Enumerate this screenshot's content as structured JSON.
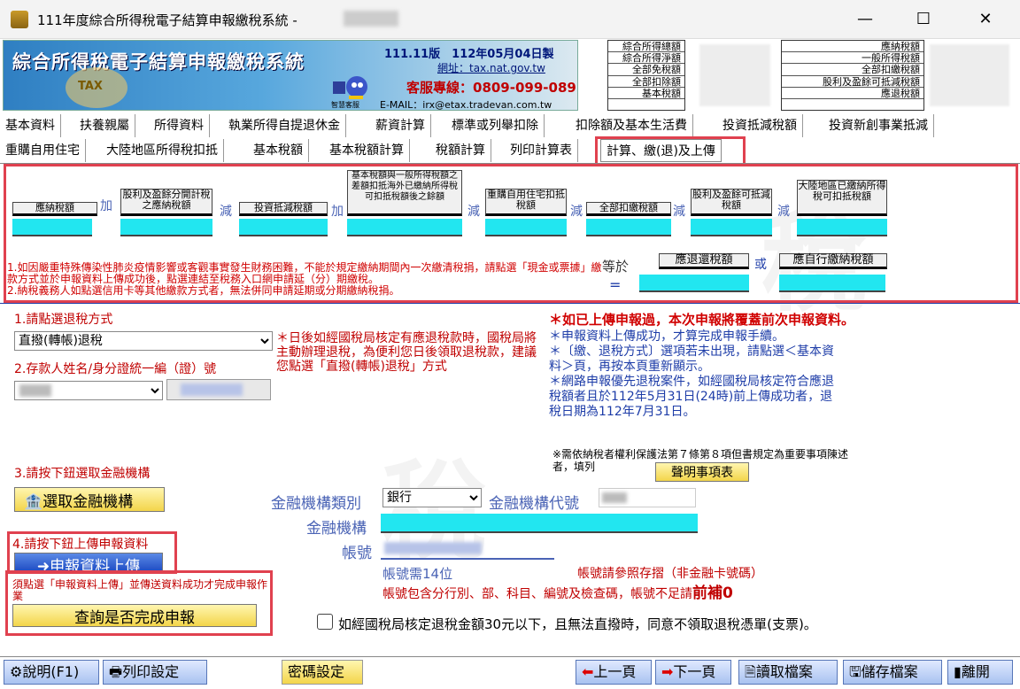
{
  "window": {
    "title": "111年度綜合所得稅電子結算申報繳稅系統 -",
    "minimize": "—",
    "maximize": "☐",
    "close": "✕"
  },
  "banner": {
    "title": "綜合所得稅電子結算申報繳稅系統",
    "version": "111.11版　112年05月04日製",
    "url": "網址：tax.nat.gov.tw",
    "phone": "客服專線：0809-099-089",
    "email": "E-MAIL：irx@etax.tradevan.com.tw",
    "robot_label": "智慧客服",
    "tax_badge": "TAX"
  },
  "summary_left": [
    "綜合所得總額",
    "綜合所得淨額",
    "全部免稅額",
    "全部扣除額",
    "基本稅額"
  ],
  "summary_right": [
    "應納稅額",
    "一般所得稅額",
    "全部扣繳稅額",
    "股利及盈餘可抵減稅額",
    "應退稅額"
  ],
  "tabs_row1": [
    "基本資料",
    "扶養親屬",
    "所得資料",
    "執業所得自提退休金",
    "薪資計算",
    "標準或列舉扣除",
    "扣除額及基本生活費",
    "投資抵減稅額",
    "投資新創事業抵減"
  ],
  "tabs_row2": [
    "重購自用住宅",
    "大陸地區所得稅扣抵",
    "基本稅額",
    "基本稅額計算",
    "稅額計算",
    "列印計算表",
    "計算、繳(退)及上傳"
  ],
  "calc": {
    "labels": [
      "應納稅額",
      "股利及盈餘分開計稅之應納稅額",
      "投資抵減稅額",
      "基本稅額與一般所得稅額之差額扣抵海外已繳納所得稅可扣抵稅額後之餘額",
      "重購自用住宅扣抵稅額",
      "全部扣繳稅額",
      "股利及盈餘可抵減稅額",
      "大陸地區已繳納所得稅可扣抵稅額"
    ],
    "ops": [
      "加",
      "減",
      "加",
      "減",
      "減",
      "減",
      "減"
    ],
    "equals": "等於",
    "or": "或",
    "eq_sign": "=",
    "refund_label": "應退還稅額",
    "pay_label": "應自行繳納稅額",
    "notes": [
      "1.如因嚴重特殊傳染性肺炎疫情影響或客觀事實發生財務困難，不能於規定繳納期間內一次繳清稅捐，請點選「現金或票據」繳款方式並於申報資料上傳成功後，點選連結至稅務入口網申請延（分）期繳稅。",
      "2.納稅義務人如點選信用卡等其他繳款方式者，無法併同申請延期或分期繳納稅捐。"
    ]
  },
  "refund": {
    "step1": "1.請點選退稅方式",
    "method": "直撥(轉帳)退稅",
    "hint": "＊日後如經國稅局核定有應退稅款時，國稅局將主動辦理退稅，為便利您日後領取退稅款，建議您點選「直撥(轉帳)退稅」方式",
    "step2": "2.存款人姓名/身分證統一編（證）號",
    "step3": "3.請按下鈕選取金融機構",
    "select_bank": "選取金融機構",
    "step4": "4.請按下鈕上傳申報資料",
    "upload": "申報資料上傳",
    "must_note": "須點選「申報資料上傳」並傳送資料成功才完成申報作業",
    "query": "查詢是否完成申報"
  },
  "info": {
    "warn": "＊如已上傳申報過，本次申報將覆蓋前次申報資料。",
    "lines": [
      "＊申報資料上傳成功，才算完成申報手續。",
      "＊〔繳、退稅方式〕選項若未出現，請點選＜基本資料＞頁，再按本頁重新顯示。",
      "＊網路申報優先退稅案件，如經國稅局核定符合應退稅額者且於112年5月31日(24時)前上傳成功者，退稅日期為112年7月31日。"
    ],
    "privacy": "※需依納稅者權利保護法第７條第８項但書規定為重要事項陳述者，填列",
    "declare_btn": "聲明事項表"
  },
  "bank": {
    "type_label": "金融機構類別",
    "type_value": "銀行",
    "code_label": "金融機構代號",
    "name_label": "金融機構",
    "acct_label": "帳號",
    "acct_note": "帳號需14位",
    "acct_note2": "帳號請參照存摺（非金融卡號碼）",
    "acct_note3": "帳號包含分行別、部、科目、編號及檢查碼，帳號不足請",
    "pad": "前補0"
  },
  "checkbox_label": "如經國稅局核定退稅金額30元以下，且無法直撥時，同意不領取退稅憑單(支票)。",
  "toolbar": {
    "help": "說明(F1)",
    "print_setting": "列印設定",
    "password": "密碼設定",
    "prev": "上一頁",
    "next": "下一頁",
    "open": "讀取檔案",
    "save": "儲存檔案",
    "exit": "離開"
  }
}
